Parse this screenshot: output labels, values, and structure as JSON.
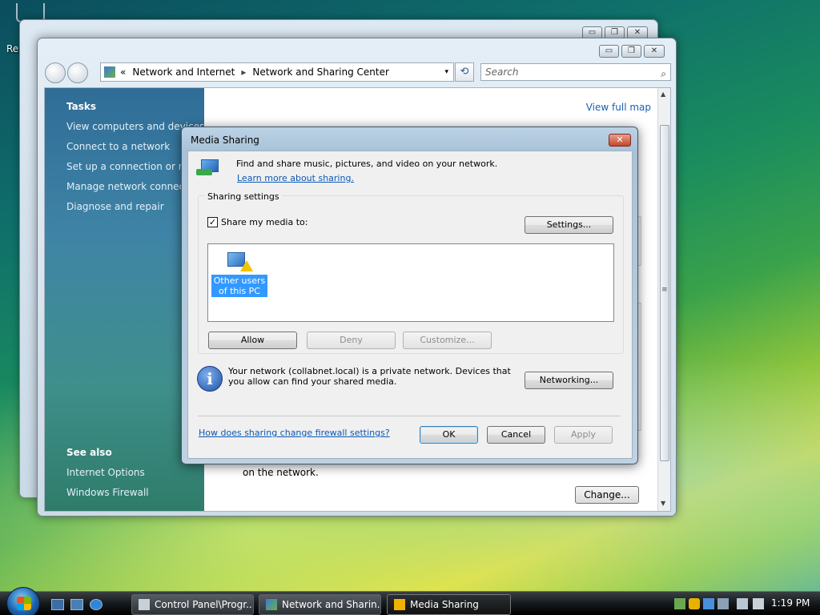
{
  "desktop": {
    "icon_label": "Re"
  },
  "back_window": {
    "controls": {
      "min": "▭",
      "max": "❐",
      "close": "✕"
    }
  },
  "main_window": {
    "controls": {
      "min": "▭",
      "max": "❐",
      "close": "✕"
    },
    "address": {
      "chevron": "«",
      "crumbs": [
        "Network and Internet",
        "Network and Sharing Center"
      ],
      "separator": "▸",
      "dropdown": "▾"
    },
    "refresh": "⟲",
    "search_placeholder": "Search",
    "search_icon": "⌕",
    "left_pane": {
      "tasks_heading": "Tasks",
      "tasks": [
        "View computers and devices",
        "Connect to a network",
        "Set up a connection or netw",
        "Manage network connectio",
        "Diagnose and repair"
      ],
      "see_also_heading": "See also",
      "see_also": [
        "Internet Options",
        "Windows Firewall"
      ]
    },
    "right_pane": {
      "view_full_map": "View full map",
      "body_text": "on the network.",
      "change_button": "Change..."
    },
    "scrollbar": {
      "up": "▲",
      "down": "▼",
      "grip": "≡"
    }
  },
  "dialog": {
    "title": "Media Sharing",
    "close": "✕",
    "header_text": "Find and share music, pictures, and video on your network.",
    "learn_more_link": "Learn more about sharing.",
    "group_label": "Sharing settings",
    "share_checkbox_label": "Share my media to:",
    "share_checked": true,
    "check_mark": "✓",
    "settings_button": "Settings...",
    "list_item": "Other users of this PC",
    "allow_button": "Allow",
    "deny_button": "Deny",
    "customize_button": "Customize...",
    "info_icon": "i",
    "info_text": "Your network (collabnet.local) is a private network. Devices that you allow can find your shared media.",
    "networking_button": "Networking...",
    "firewall_link": "How does sharing change firewall settings?",
    "ok_button": "OK",
    "cancel_button": "Cancel",
    "apply_button": "Apply"
  },
  "taskbar": {
    "buttons": [
      "Control Panel\\Progr...",
      "Network and Sharin...",
      "Media Sharing"
    ],
    "active_index": 2,
    "clock": "1:19 PM"
  }
}
